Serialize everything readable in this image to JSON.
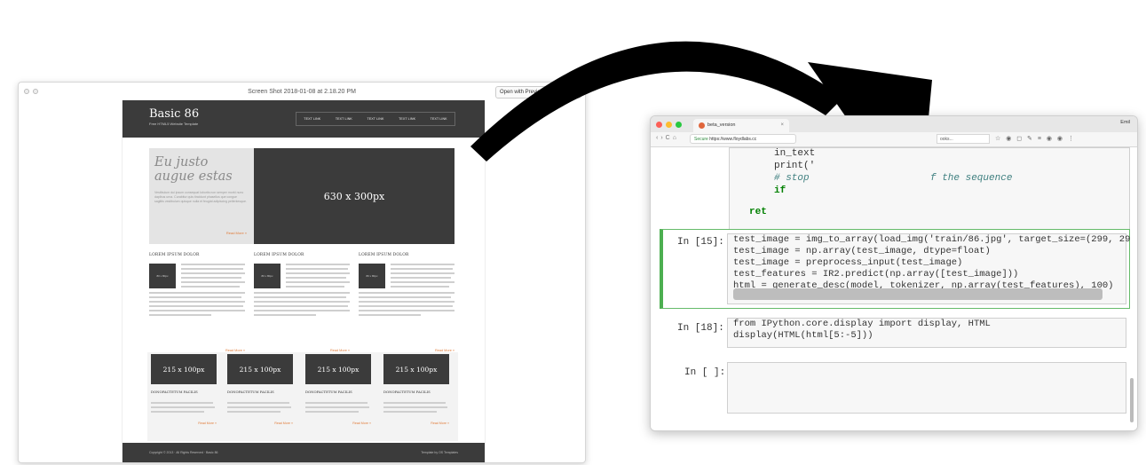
{
  "preview": {
    "title": "Screen Shot 2018-01-08 at 2.18.20 PM",
    "open_with": "Open with Preview",
    "site": {
      "title": "Basic 86",
      "subtitle": "Free HTML5 Website Template",
      "nav": [
        "TEXT LINK",
        "TEXT LINK",
        "TEXT LINK",
        "TEXT LINK",
        "TEXT LINK"
      ],
      "hero_heading": "Eu justo augue estas",
      "hero_text": "Vestibulum dui ipsum consequat lobortis non semper morbi nunc dapibus urna. Curabitur quis tincidunt phasellus que congue sagittis vestibulum quisque nulla et feugiat adipiscing pellentesque.",
      "hero_more": "Read More »",
      "hero_image": "630 x 300px",
      "columns": [
        {
          "heading": "LOREM IPSUM DOLOR",
          "thumb": "80 x 80px",
          "more": "Read More »"
        },
        {
          "heading": "LOREM IPSUM DOLOR",
          "thumb": "80 x 80px",
          "more": "Read More »"
        },
        {
          "heading": "LOREM IPSUM DOLOR",
          "thumb": "80 x 80px",
          "more": "Read More »"
        }
      ],
      "boxes": [
        {
          "image": "215 x 100px",
          "heading": "DONOFACTETUM FACILIS",
          "more": "Read More »"
        },
        {
          "image": "215 x 100px",
          "heading": "DONOFACTETUM FACILIS",
          "more": "Read More »"
        },
        {
          "image": "215 x 100px",
          "heading": "DONOFACTETUM FACILIS",
          "more": "Read More »"
        },
        {
          "image": "215 x 100px",
          "heading": "DONOFACTETUM FACILIS",
          "more": "Read More »"
        }
      ],
      "footer_left": "Copyright © 2013 · All Rights Reserved · Basic 86",
      "footer_right": "Template by OS Templates"
    }
  },
  "browser": {
    "tab_title": "beta_version",
    "user": "Emil",
    "secure_label": "Secure",
    "url": "https://www.floydlabs.cc",
    "url_tail": "ooks...",
    "code_top": {
      "line1": "in_text",
      "line2": "print('",
      "line3": "# stop",
      "line3b": "f the sequence",
      "line4": "if",
      "line5": "ret"
    },
    "cell_15": {
      "prompt": "In [15]:",
      "lines": [
        "test_image = img_to_array(load_img('train/86.jpg', target_size=(299, 29",
        "test_image = np.array(test_image, dtype=float)",
        "test_image = preprocess_input(test_image)",
        "test_features = IR2.predict(np.array([test_image]))",
        "html = generate_desc(model, tokenizer, np.array(test_features), 100)"
      ]
    },
    "cell_18": {
      "prompt": "In [18]:",
      "lines": [
        "from IPython.core.display import display, HTML",
        "display(HTML(html[5:-5]))"
      ]
    },
    "cell_empty": {
      "prompt": "In [ ]:"
    }
  },
  "colors": {
    "accent_orange": "#e07b39",
    "dark_gray": "#3b3b3b",
    "cell_selected": "#4caf50"
  }
}
